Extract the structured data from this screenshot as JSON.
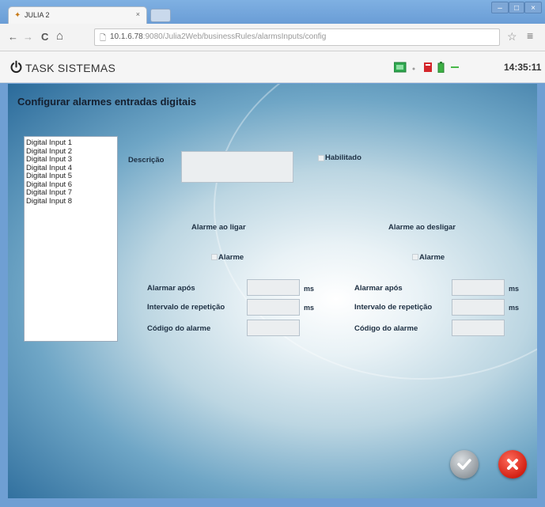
{
  "browser": {
    "tab_title": "JULIA 2",
    "tab_close": "×",
    "url_host": "10.1.6.78",
    "url_rest": ":9080/Julia2Web/businessRules/alarmsInputs/config",
    "back": "←",
    "forward": "→",
    "reload": "C",
    "home": "⌂",
    "window_buttons": {
      "minimize": "–",
      "maximize": "□",
      "close": "×"
    }
  },
  "header": {
    "brand": "TASK SISTEMAS",
    "clock": "14:35:11",
    "status_colors": {
      "network": "#2fa84f",
      "alert": "#d4262b",
      "battery": "#3cb043",
      "signal": "#49b84a"
    }
  },
  "page": {
    "title": "Configurar alarmes entradas digitais",
    "inputs": [
      "Digital Input 1",
      "Digital Input 2",
      "Digital Input 3",
      "Digital Input 4",
      "Digital Input 5",
      "Digital Input 6",
      "Digital Input 7",
      "Digital Input 8"
    ],
    "descricao_label": "Descrição",
    "descricao_value": "",
    "habilitado_label": "Habilitado",
    "on": {
      "section_title": "Alarme ao ligar",
      "alarme_label": "Alarme",
      "alarmar_apos_label": "Alarmar após",
      "alarmar_apos_value": "",
      "alarmar_apos_unit": "ms",
      "intervalo_label": "Intervalo de repetição",
      "intervalo_value": "",
      "intervalo_unit": "ms",
      "codigo_label": "Código do alarme",
      "codigo_value": ""
    },
    "off": {
      "section_title": "Alarme ao desligar",
      "alarme_label": "Alarme",
      "alarmar_apos_label": "Alarmar após",
      "alarmar_apos_value": "",
      "alarmar_apos_unit": "ms",
      "intervalo_label": "Intervalo de repetição",
      "intervalo_value": "",
      "intervalo_unit": "ms",
      "codigo_label": "Código do alarme",
      "codigo_value": ""
    }
  },
  "icons": {
    "confirm": "check-icon",
    "cancel": "close-icon",
    "power": "power-icon"
  }
}
